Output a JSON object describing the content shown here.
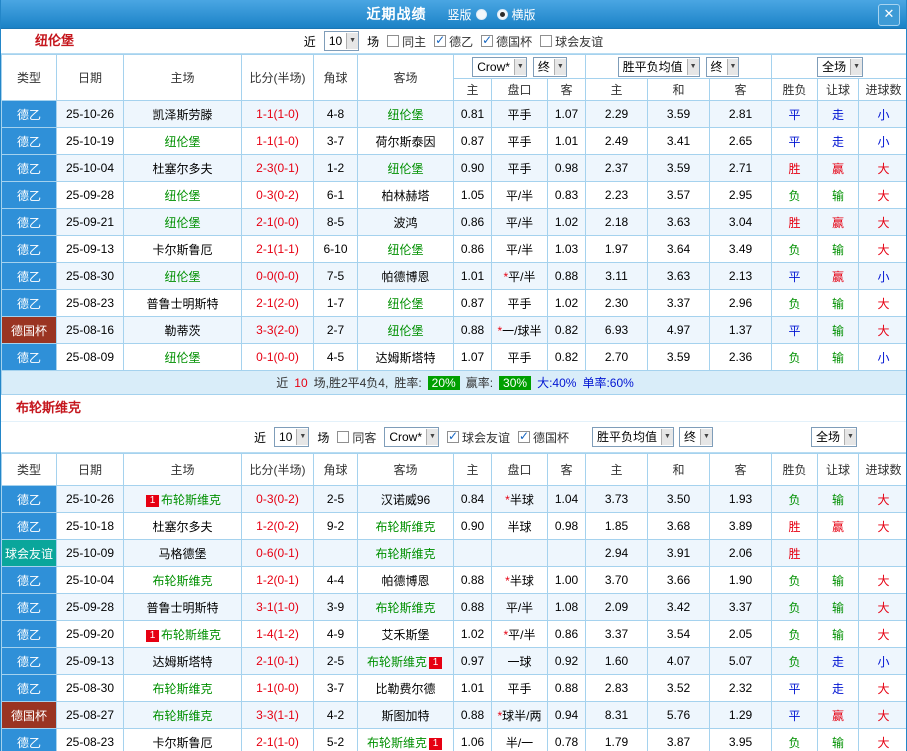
{
  "topbar": {
    "title": "近期战绩",
    "vertical_label": "竖版",
    "horizontal_label": "横版",
    "close_glyph": "✕"
  },
  "filter_text": {
    "near": "近",
    "matches": "场"
  },
  "dropdowns": {
    "count": "10",
    "bookmaker": "Crow*",
    "final": "终",
    "avg": "胜平负均值",
    "fullmatch": "全场"
  },
  "columns": [
    "类型",
    "日期",
    "主场",
    "比分(半场)",
    "角球",
    "客场",
    "主",
    "盘口",
    "客",
    "主",
    "和",
    "客",
    "胜负",
    "让球",
    "进球数"
  ],
  "sections": [
    {
      "team": "纽伦堡",
      "filters": {
        "checkboxes": [
          {
            "label": "同主",
            "checked": false
          },
          {
            "label": "德乙",
            "checked": true
          },
          {
            "label": "德国杯",
            "checked": true
          },
          {
            "label": "球会友谊",
            "checked": false
          }
        ]
      },
      "rows": [
        {
          "lg": "德乙",
          "date": "25-10-26",
          "home": {
            "n": "凯泽斯劳滕"
          },
          "score": "1-1(1-0)",
          "corner": "4-8",
          "away": {
            "n": "纽伦堡",
            "f": true
          },
          "odds": [
            "0.81",
            "平手",
            "1.07"
          ],
          "avg": [
            "2.29",
            "3.59",
            "2.81"
          ],
          "res": [
            "平",
            "走",
            "小"
          ]
        },
        {
          "lg": "德乙",
          "date": "25-10-19",
          "home": {
            "n": "纽伦堡",
            "f": true
          },
          "score": "1-1(1-0)",
          "corner": "3-7",
          "away": {
            "n": "荷尔斯泰因"
          },
          "odds": [
            "0.87",
            "平手",
            "1.01"
          ],
          "avg": [
            "2.49",
            "3.41",
            "2.65"
          ],
          "res": [
            "平",
            "走",
            "小"
          ]
        },
        {
          "lg": "德乙",
          "date": "25-10-04",
          "home": {
            "n": "杜塞尔多夫"
          },
          "score": "2-3(0-1)",
          "corner": "1-2",
          "away": {
            "n": "纽伦堡",
            "f": true
          },
          "odds": [
            "0.90",
            "平手",
            "0.98"
          ],
          "avg": [
            "2.37",
            "3.59",
            "2.71"
          ],
          "res": [
            "胜",
            "赢",
            "大"
          ]
        },
        {
          "lg": "德乙",
          "date": "25-09-28",
          "home": {
            "n": "纽伦堡",
            "f": true
          },
          "score": "0-3(0-2)",
          "corner": "6-1",
          "away": {
            "n": "柏林赫塔"
          },
          "odds": [
            "1.05",
            "平/半",
            "0.83"
          ],
          "avg": [
            "2.23",
            "3.57",
            "2.95"
          ],
          "res": [
            "负",
            "输",
            "大"
          ]
        },
        {
          "lg": "德乙",
          "date": "25-09-21",
          "home": {
            "n": "纽伦堡",
            "f": true
          },
          "score": "2-1(0-0)",
          "corner": "8-5",
          "away": {
            "n": "波鸿"
          },
          "odds": [
            "0.86",
            "平/半",
            "1.02"
          ],
          "avg": [
            "2.18",
            "3.63",
            "3.04"
          ],
          "res": [
            "胜",
            "赢",
            "大"
          ]
        },
        {
          "lg": "德乙",
          "date": "25-09-13",
          "home": {
            "n": "卡尔斯鲁厄"
          },
          "score": "2-1(1-1)",
          "corner": "6-10",
          "away": {
            "n": "纽伦堡",
            "f": true
          },
          "odds": [
            "0.86",
            "平/半",
            "1.03"
          ],
          "avg": [
            "1.97",
            "3.64",
            "3.49"
          ],
          "res": [
            "负",
            "输",
            "大"
          ]
        },
        {
          "lg": "德乙",
          "date": "25-08-30",
          "home": {
            "n": "纽伦堡",
            "f": true
          },
          "score": "0-0(0-0)",
          "corner": "7-5",
          "away": {
            "n": "帕德博恩"
          },
          "odds": [
            "1.01",
            "*平/半",
            "0.88"
          ],
          "avg": [
            "3.11",
            "3.63",
            "2.13"
          ],
          "res": [
            "平",
            "赢",
            "小"
          ]
        },
        {
          "lg": "德乙",
          "date": "25-08-23",
          "home": {
            "n": "普鲁士明斯特"
          },
          "score": "2-1(2-0)",
          "corner": "1-7",
          "away": {
            "n": "纽伦堡",
            "f": true
          },
          "odds": [
            "0.87",
            "平手",
            "1.02"
          ],
          "avg": [
            "2.30",
            "3.37",
            "2.96"
          ],
          "res": [
            "负",
            "输",
            "大"
          ]
        },
        {
          "lg": "德国杯",
          "date": "25-08-16",
          "home": {
            "n": "勒蒂茨"
          },
          "score": "3-3(2-0)",
          "corner": "2-7",
          "away": {
            "n": "纽伦堡",
            "f": true
          },
          "odds": [
            "0.88",
            "*一/球半",
            "0.82"
          ],
          "avg": [
            "6.93",
            "4.97",
            "1.37"
          ],
          "res": [
            "平",
            "输",
            "大"
          ]
        },
        {
          "lg": "德乙",
          "date": "25-08-09",
          "home": {
            "n": "纽伦堡",
            "f": true
          },
          "score": "0-1(0-0)",
          "corner": "4-5",
          "away": {
            "n": "达姆斯塔特"
          },
          "odds": [
            "1.07",
            "平手",
            "0.82"
          ],
          "avg": [
            "2.70",
            "3.59",
            "2.36"
          ],
          "res": [
            "负",
            "输",
            "小"
          ]
        }
      ],
      "footer": [
        {
          "t": "近",
          "s": "plain"
        },
        {
          "t": "10",
          "s": "red"
        },
        {
          "t": "场,胜2平4负4,",
          "s": "plain"
        },
        {
          "t": "胜率:",
          "s": "plain"
        },
        {
          "t": "20%",
          "s": "badge"
        },
        {
          "t": "赢率:",
          "s": "plain"
        },
        {
          "t": "30%",
          "s": "badge"
        },
        {
          "t": "大:40%",
          "s": "blue"
        },
        {
          "t": "单率:60%",
          "s": "blue"
        }
      ]
    },
    {
      "team": "布轮斯维克",
      "filters": {
        "checkboxes": [
          {
            "label": "同客",
            "checked": false
          },
          {
            "label": "球会友谊",
            "checked": true
          },
          {
            "label": "德国杯",
            "checked": true
          }
        ]
      },
      "rows": [
        {
          "lg": "德乙",
          "date": "25-10-26",
          "home": {
            "n": "布轮斯维克",
            "f": true,
            "bl": "1"
          },
          "score": "0-3(0-2)",
          "corner": "2-5",
          "away": {
            "n": "汉诺威96"
          },
          "odds": [
            "0.84",
            "*半球",
            "1.04"
          ],
          "avg": [
            "3.73",
            "3.50",
            "1.93"
          ],
          "res": [
            "负",
            "输",
            "大"
          ]
        },
        {
          "lg": "德乙",
          "date": "25-10-18",
          "home": {
            "n": "杜塞尔多夫"
          },
          "score": "1-2(0-2)",
          "corner": "9-2",
          "away": {
            "n": "布轮斯维克",
            "f": true
          },
          "odds": [
            "0.90",
            "半球",
            "0.98"
          ],
          "avg": [
            "1.85",
            "3.68",
            "3.89"
          ],
          "res": [
            "胜",
            "赢",
            "大"
          ]
        },
        {
          "lg": "球会友谊",
          "date": "25-10-09",
          "home": {
            "n": "马格德堡"
          },
          "score": "0-6(0-1)",
          "corner": "",
          "away": {
            "n": "布轮斯维克",
            "f": true
          },
          "odds": [
            "",
            "",
            ""
          ],
          "avg": [
            "2.94",
            "3.91",
            "2.06"
          ],
          "res": [
            "胜",
            "",
            ""
          ]
        },
        {
          "lg": "德乙",
          "date": "25-10-04",
          "home": {
            "n": "布轮斯维克",
            "f": true
          },
          "score": "1-2(0-1)",
          "corner": "4-4",
          "away": {
            "n": "帕德博恩"
          },
          "odds": [
            "0.88",
            "*半球",
            "1.00"
          ],
          "avg": [
            "3.70",
            "3.66",
            "1.90"
          ],
          "res": [
            "负",
            "输",
            "大"
          ]
        },
        {
          "lg": "德乙",
          "date": "25-09-28",
          "home": {
            "n": "普鲁士明斯特"
          },
          "score": "3-1(1-0)",
          "corner": "3-9",
          "away": {
            "n": "布轮斯维克",
            "f": true
          },
          "odds": [
            "0.88",
            "平/半",
            "1.08"
          ],
          "avg": [
            "2.09",
            "3.42",
            "3.37"
          ],
          "res": [
            "负",
            "输",
            "大"
          ]
        },
        {
          "lg": "德乙",
          "date": "25-09-20",
          "home": {
            "n": "布轮斯维克",
            "f": true,
            "bl": "1"
          },
          "score": "1-4(1-2)",
          "corner": "4-9",
          "away": {
            "n": "艾禾斯堡"
          },
          "odds": [
            "1.02",
            "*平/半",
            "0.86"
          ],
          "avg": [
            "3.37",
            "3.54",
            "2.05"
          ],
          "res": [
            "负",
            "输",
            "大"
          ]
        },
        {
          "lg": "德乙",
          "date": "25-09-13",
          "home": {
            "n": "达姆斯塔特"
          },
          "score": "2-1(0-1)",
          "corner": "2-5",
          "away": {
            "n": "布轮斯维克",
            "f": true,
            "br": "1"
          },
          "odds": [
            "0.97",
            "一球",
            "0.92"
          ],
          "avg": [
            "1.60",
            "4.07",
            "5.07"
          ],
          "res": [
            "负",
            "走",
            "小"
          ]
        },
        {
          "lg": "德乙",
          "date": "25-08-30",
          "home": {
            "n": "布轮斯维克",
            "f": true
          },
          "score": "1-1(0-0)",
          "corner": "3-7",
          "away": {
            "n": "比勒费尔德"
          },
          "odds": [
            "1.01",
            "平手",
            "0.88"
          ],
          "avg": [
            "2.83",
            "3.52",
            "2.32"
          ],
          "res": [
            "平",
            "走",
            "大"
          ]
        },
        {
          "lg": "德国杯",
          "date": "25-08-27",
          "home": {
            "n": "布轮斯维克",
            "f": true
          },
          "score": "3-3(1-1)",
          "corner": "4-2",
          "away": {
            "n": "斯图加特"
          },
          "odds": [
            "0.88",
            "*球半/两",
            "0.94"
          ],
          "avg": [
            "8.31",
            "5.76",
            "1.29"
          ],
          "res": [
            "平",
            "赢",
            "大"
          ]
        },
        {
          "lg": "德乙",
          "date": "25-08-23",
          "home": {
            "n": "卡尔斯鲁厄"
          },
          "score": "2-1(1-0)",
          "corner": "5-2",
          "away": {
            "n": "布轮斯维克",
            "f": true,
            "br": "1"
          },
          "odds": [
            "1.06",
            "半/一",
            "0.78"
          ],
          "avg": [
            "1.79",
            "3.87",
            "3.95"
          ],
          "res": [
            "负",
            "输",
            "大"
          ]
        }
      ]
    }
  ]
}
